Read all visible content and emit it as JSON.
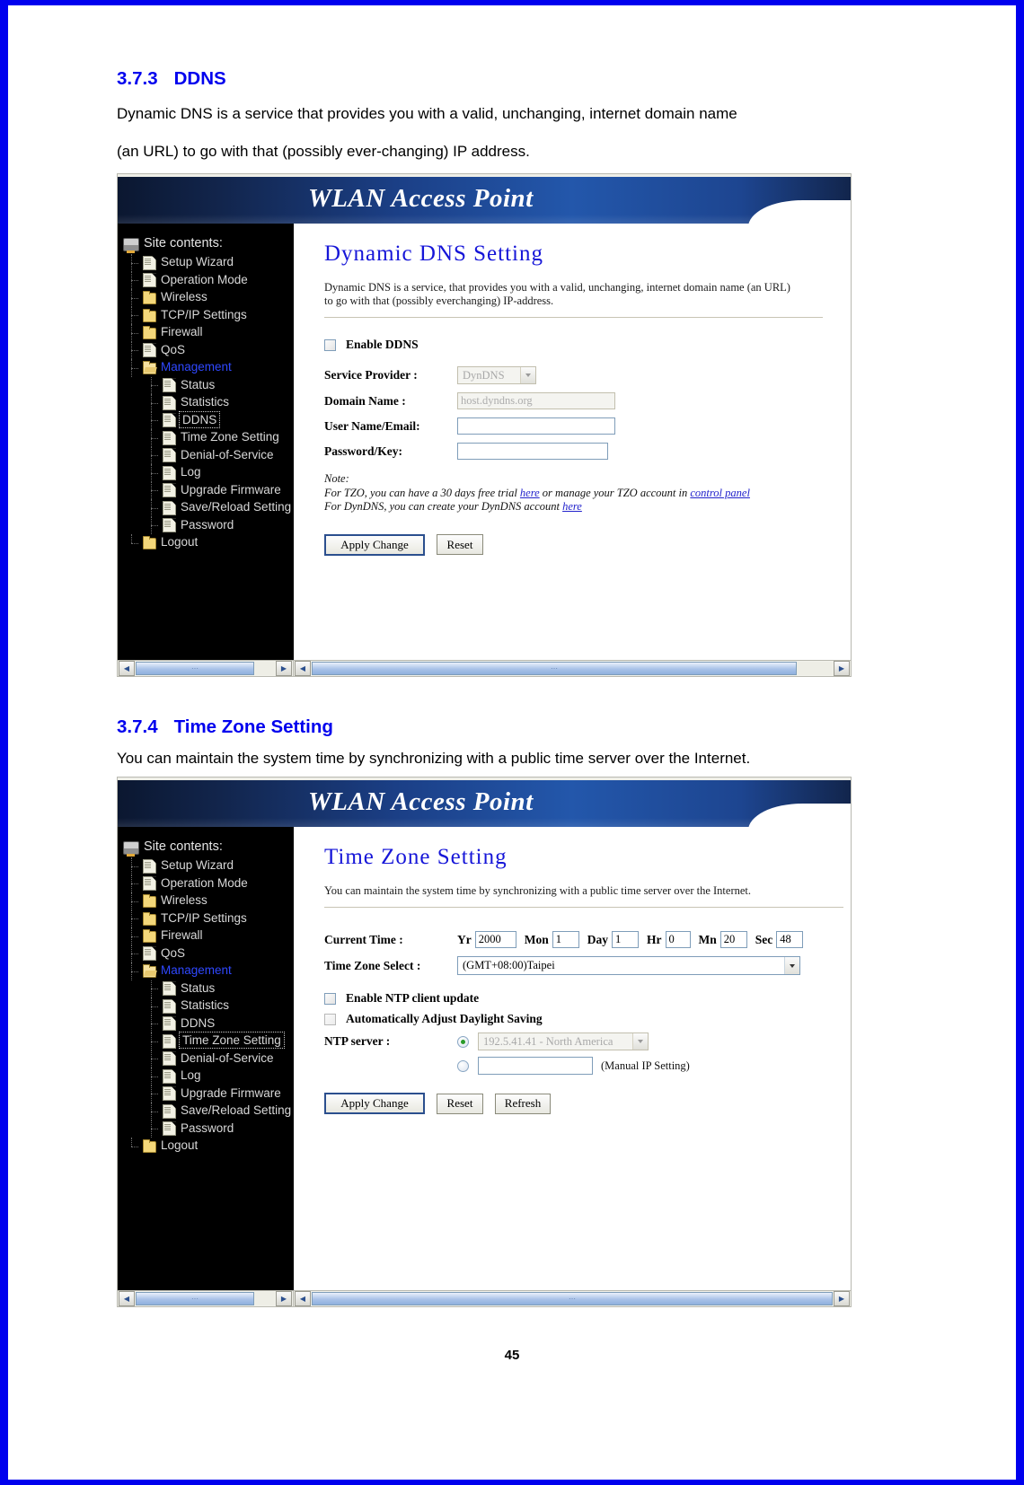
{
  "page": {
    "number": "45"
  },
  "sections": [
    {
      "num": "3.7.3",
      "title": "DDNS",
      "paragraphs": [
        "Dynamic DNS is a service that provides you with a valid, unchanging, internet domain name",
        "(an URL) to go with that (possibly ever-changing) IP address."
      ]
    },
    {
      "num": "3.7.4",
      "title": "Time Zone Setting",
      "paragraphs": [
        "You can maintain the system time by synchronizing with a public time server over the Internet."
      ]
    }
  ],
  "shot1": {
    "banner_title": "WLAN Access Point",
    "sidebar": {
      "root_label": "Site contents:",
      "root_icon": "site-contents-icon",
      "items": [
        {
          "label": "Setup Wizard",
          "icon": "page-icon",
          "level": 1,
          "state": "normal"
        },
        {
          "label": "Operation Mode",
          "icon": "page-icon",
          "level": 1,
          "state": "normal"
        },
        {
          "label": "Wireless",
          "icon": "folder-icon",
          "level": 1,
          "state": "normal"
        },
        {
          "label": "TCP/IP Settings",
          "icon": "folder-icon",
          "level": 1,
          "state": "normal"
        },
        {
          "label": "Firewall",
          "icon": "folder-icon",
          "level": 1,
          "state": "normal"
        },
        {
          "label": "QoS",
          "icon": "page-icon",
          "level": 1,
          "state": "normal"
        },
        {
          "label": "Management",
          "icon": "folder-open-icon",
          "level": 1,
          "state": "expanded"
        },
        {
          "label": "Status",
          "icon": "page-icon",
          "level": 2,
          "state": "normal"
        },
        {
          "label": "Statistics",
          "icon": "page-icon",
          "level": 2,
          "state": "normal"
        },
        {
          "label": "DDNS",
          "icon": "page-icon",
          "level": 2,
          "state": "focused"
        },
        {
          "label": "Time Zone Setting",
          "icon": "page-icon",
          "level": 2,
          "state": "normal"
        },
        {
          "label": "Denial-of-Service",
          "icon": "page-icon",
          "level": 2,
          "state": "normal"
        },
        {
          "label": "Log",
          "icon": "page-icon",
          "level": 2,
          "state": "normal"
        },
        {
          "label": "Upgrade Firmware",
          "icon": "page-icon",
          "level": 2,
          "state": "normal"
        },
        {
          "label": "Save/Reload Setting",
          "icon": "page-icon",
          "level": 2,
          "state": "normal"
        },
        {
          "label": "Password",
          "icon": "page-icon",
          "level": 2,
          "state": "normal"
        },
        {
          "label": "Logout",
          "icon": "folder-icon",
          "level": 1,
          "state": "normal"
        }
      ]
    },
    "pane": {
      "title": "Dynamic DNS  Setting",
      "desc_line1": "Dynamic DNS is a service, that provides you with a valid, unchanging, internet domain name (an URL)",
      "desc_line2": "to go with that (possibly everchanging) IP-address.",
      "enable_ddns_label": "Enable DDNS",
      "enable_ddns_checked": false,
      "fields": [
        {
          "label": "Service Provider :",
          "kind": "select",
          "value": "DynDNS",
          "disabled": true
        },
        {
          "label": "Domain Name :",
          "kind": "text",
          "value": "host.dyndns.org",
          "disabled": true
        },
        {
          "label": "User Name/Email:",
          "kind": "text",
          "value": "",
          "disabled": false
        },
        {
          "label": "Password/Key:",
          "kind": "text",
          "value": "",
          "disabled": false
        }
      ],
      "note_heading": "Note:",
      "note_line1_a": "For TZO, you can have a 30 days free trial ",
      "note_line1_link1": "here",
      "note_line1_b": " or manage your TZO account in ",
      "note_line1_link2": "control panel",
      "note_line2_a": "For DynDNS, you can create your DynDNS account ",
      "note_line2_link1": "here",
      "buttons": [
        {
          "label": "Apply Change",
          "style": "primary"
        },
        {
          "label": "Reset",
          "style": "normal"
        }
      ]
    }
  },
  "shot2": {
    "banner_title": "WLAN Access Point",
    "sidebar": {
      "root_label": "Site contents:",
      "root_icon": "site-contents-icon",
      "items": [
        {
          "label": "Setup Wizard",
          "icon": "page-icon",
          "level": 1,
          "state": "normal"
        },
        {
          "label": "Operation Mode",
          "icon": "page-icon",
          "level": 1,
          "state": "normal"
        },
        {
          "label": "Wireless",
          "icon": "folder-icon",
          "level": 1,
          "state": "normal"
        },
        {
          "label": "TCP/IP Settings",
          "icon": "folder-icon",
          "level": 1,
          "state": "normal"
        },
        {
          "label": "Firewall",
          "icon": "folder-icon",
          "level": 1,
          "state": "normal"
        },
        {
          "label": "QoS",
          "icon": "page-icon",
          "level": 1,
          "state": "normal"
        },
        {
          "label": "Management",
          "icon": "folder-open-icon",
          "level": 1,
          "state": "expanded"
        },
        {
          "label": "Status",
          "icon": "page-icon",
          "level": 2,
          "state": "normal"
        },
        {
          "label": "Statistics",
          "icon": "page-icon",
          "level": 2,
          "state": "normal"
        },
        {
          "label": "DDNS",
          "icon": "page-icon",
          "level": 2,
          "state": "normal"
        },
        {
          "label": "Time Zone Setting",
          "icon": "page-icon",
          "level": 2,
          "state": "focused"
        },
        {
          "label": "Denial-of-Service",
          "icon": "page-icon",
          "level": 2,
          "state": "normal"
        },
        {
          "label": "Log",
          "icon": "page-icon",
          "level": 2,
          "state": "normal"
        },
        {
          "label": "Upgrade Firmware",
          "icon": "page-icon",
          "level": 2,
          "state": "normal"
        },
        {
          "label": "Save/Reload Setting",
          "icon": "page-icon",
          "level": 2,
          "state": "normal"
        },
        {
          "label": "Password",
          "icon": "page-icon",
          "level": 2,
          "state": "normal"
        },
        {
          "label": "Logout",
          "icon": "folder-icon",
          "level": 1,
          "state": "normal"
        }
      ]
    },
    "pane": {
      "title": "Time Zone Setting",
      "desc_line1": "You can maintain the system time by synchronizing with a public time server over the Internet.",
      "current_time_label": "Current Time :",
      "time_parts": [
        {
          "unit": "Yr",
          "value": "2000"
        },
        {
          "unit": "Mon",
          "value": "1"
        },
        {
          "unit": "Day",
          "value": "1"
        },
        {
          "unit": "Hr",
          "value": "0"
        },
        {
          "unit": "Mn",
          "value": "20"
        },
        {
          "unit": "Sec",
          "value": "48"
        }
      ],
      "time_zone_label": "Time Zone Select :",
      "time_zone_value": "(GMT+08:00)Taipei",
      "enable_ntp_label": "Enable NTP client update",
      "enable_ntp_checked": false,
      "daylight_label": "Automatically Adjust Daylight Saving",
      "daylight_checked": false,
      "ntp_server_label": "NTP server :",
      "ntp_preset_value": "192.5.41.41 - North America",
      "ntp_preset_selected": true,
      "ntp_manual_value": "",
      "ntp_manual_selected": false,
      "manual_ip_label": "(Manual IP Setting)",
      "buttons": [
        {
          "label": "Apply Change",
          "style": "primary"
        },
        {
          "label": "Reset",
          "style": "normal"
        },
        {
          "label": "Refresh",
          "style": "normal"
        }
      ]
    }
  }
}
